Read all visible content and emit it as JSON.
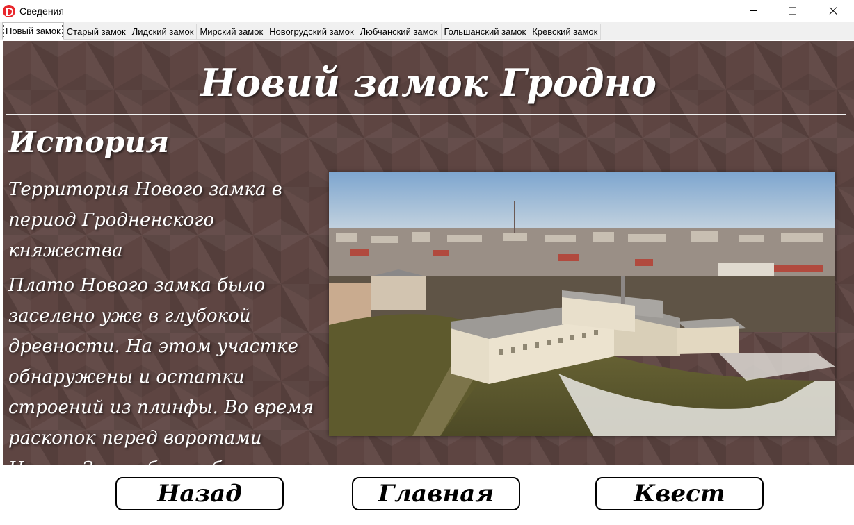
{
  "window": {
    "title": "Сведения",
    "controls": [
      "minimize",
      "maximize",
      "close"
    ]
  },
  "tabs": [
    {
      "label": "Новый замок",
      "active": true
    },
    {
      "label": "Старый замок",
      "active": false
    },
    {
      "label": "Лидский замок",
      "active": false
    },
    {
      "label": "Мирский замок",
      "active": false
    },
    {
      "label": "Новогрудский замок",
      "active": false
    },
    {
      "label": "Любчанский замок",
      "active": false
    },
    {
      "label": "Гольшанский замок",
      "active": false
    },
    {
      "label": "Кревский замок",
      "active": false
    }
  ],
  "content": {
    "title": "Новий замок Гродно",
    "section_heading": "История",
    "subheading": "Территория Нового замка в период Гродненского княжества",
    "body": "Плато Нового замка было заселено уже в глубокой древности. На этом участке обнаружены и остатки строений из плинфы. Во время раскопок перед воротами Нового Замка была обнаружена стена, которая, однако, по"
  },
  "buttons": {
    "back": "Назад",
    "home": "Главная",
    "quest": "Квест"
  },
  "colors": {
    "panel_background": "#5e4542",
    "text": "#ffffff",
    "app_icon": "#e8262b"
  }
}
